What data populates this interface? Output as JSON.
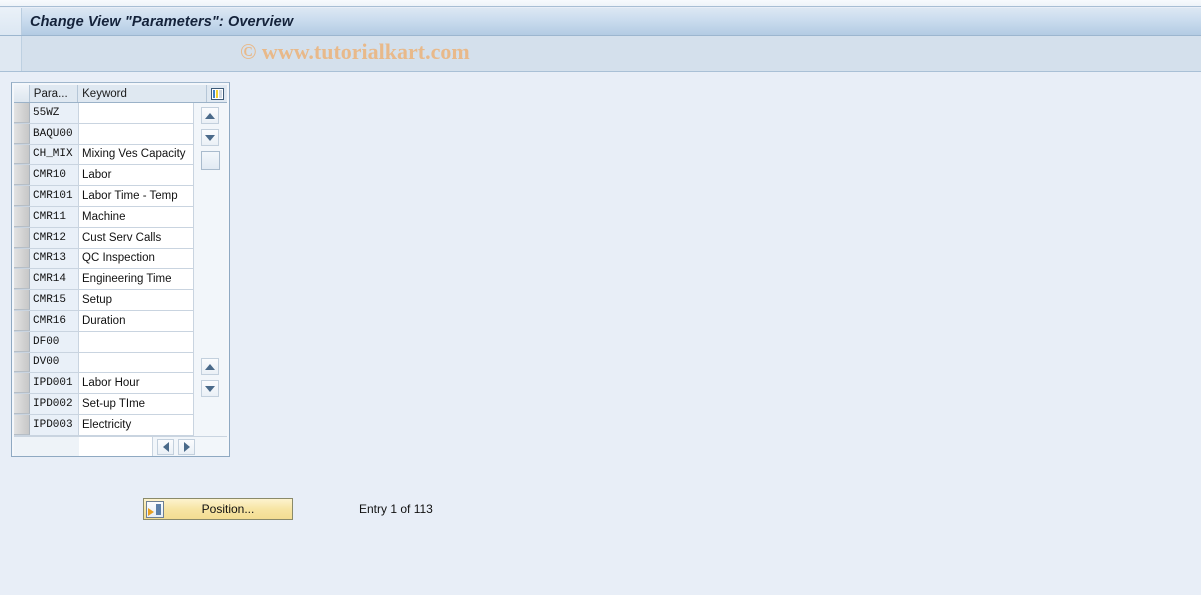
{
  "window": {
    "title": "Change View \"Parameters\": Overview"
  },
  "watermark": {
    "text": "© www.tutorialkart.com"
  },
  "table": {
    "settings_icon": "table-settings-icon",
    "columns": [
      {
        "id": "parameter",
        "label": "Para..."
      },
      {
        "id": "keyword",
        "label": "Keyword"
      }
    ],
    "rows": [
      {
        "parameter": "55WZ",
        "keyword": ""
      },
      {
        "parameter": "BAQU00",
        "keyword": ""
      },
      {
        "parameter": "CH_MIX",
        "keyword": "Mixing Ves Capacity"
      },
      {
        "parameter": "CMR10",
        "keyword": "Labor"
      },
      {
        "parameter": "CMR101",
        "keyword": "Labor Time - Temp"
      },
      {
        "parameter": "CMR11",
        "keyword": "Machine"
      },
      {
        "parameter": "CMR12",
        "keyword": "Cust Serv Calls"
      },
      {
        "parameter": "CMR13",
        "keyword": "QC Inspection"
      },
      {
        "parameter": "CMR14",
        "keyword": "Engineering Time"
      },
      {
        "parameter": "CMR15",
        "keyword": "Setup"
      },
      {
        "parameter": "CMR16",
        "keyword": "Duration"
      },
      {
        "parameter": "DF00",
        "keyword": ""
      },
      {
        "parameter": "DV00",
        "keyword": ""
      },
      {
        "parameter": "IPD001",
        "keyword": "Labor Hour"
      },
      {
        "parameter": "IPD002",
        "keyword": "Set-up TIme"
      },
      {
        "parameter": "IPD003",
        "keyword": "Electricity"
      }
    ],
    "scroll": {
      "up_icon": "scroll-up-icon",
      "down_icon": "scroll-down-icon",
      "left_icon": "scroll-left-icon",
      "right_icon": "scroll-right-icon"
    }
  },
  "footer": {
    "position_button": {
      "label": "Position...",
      "icon": "position-jump-icon"
    },
    "entry_status": "Entry 1 of 113"
  },
  "colors": {
    "page_background": "#e8eef7",
    "titlebar_start": "#dce7f3",
    "titlebar_end": "#b3cbe3",
    "subband": "#d4e0ec",
    "watermark": "#e8b98a",
    "button_yellow": "#f7e5a4",
    "para_cell": "#e9f0f8"
  }
}
